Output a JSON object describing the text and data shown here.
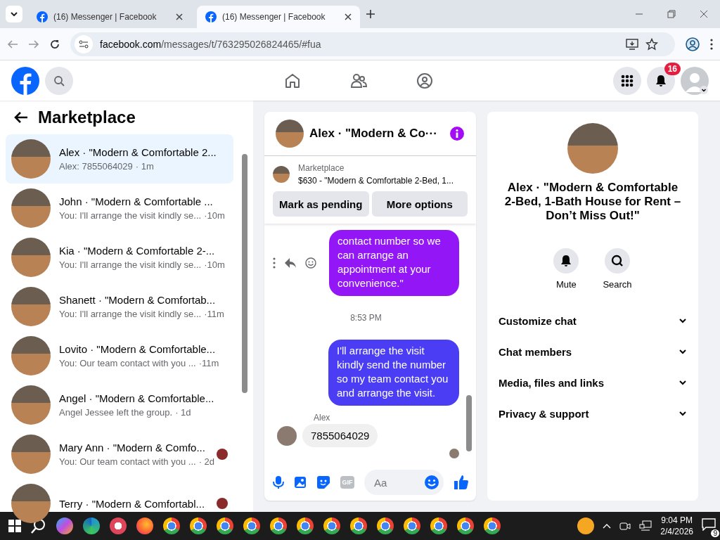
{
  "browser": {
    "tabs": [
      {
        "title": "(16) Messenger | Facebook",
        "selected": false
      },
      {
        "title": "(16) Messenger | Facebook",
        "selected": true
      }
    ],
    "url_host": "facebook.com",
    "url_path": "/messages/t/763295026824465/#fua"
  },
  "header": {
    "notification_count": "16"
  },
  "sidebar": {
    "title": "Marketplace",
    "conversations": [
      {
        "name": "Alex · \"Modern & Comfortable 2...",
        "preview": "Alex: 7855064029",
        "time": "· 1m",
        "selected": true,
        "seen": false
      },
      {
        "name": "John · \"Modern & Comfortable ...",
        "preview": "You: I'll arrange the visit kindly se...",
        "time": "·10m",
        "selected": false,
        "seen": false
      },
      {
        "name": "Kia · \"Modern & Comfortable 2-...",
        "preview": "You: I'll arrange the visit kindly se...",
        "time": "·10m",
        "selected": false,
        "seen": false
      },
      {
        "name": "Shanett · \"Modern & Comfortab...",
        "preview": "You: I'll arrange the visit kindly se...",
        "time": "·11m",
        "selected": false,
        "seen": false
      },
      {
        "name": "Lovito · \"Modern & Comfortable...",
        "preview": "You: Our team contact with you ...",
        "time": "·11m",
        "selected": false,
        "seen": false
      },
      {
        "name": "Angel · \"Modern & Comfortable...",
        "preview": "Angel Jessee left the group.",
        "time": "· 1d",
        "selected": false,
        "seen": false
      },
      {
        "name": "Mary Ann · \"Modern & Comfo...",
        "preview": "You: Our team contact with you ...",
        "time": "· 2d",
        "selected": false,
        "seen": true
      },
      {
        "name": "Terry · \"Modern & Comfortabl...",
        "selected": false,
        "seen": true
      }
    ]
  },
  "chat": {
    "title": "Alex · \"Modern & Co···",
    "listing_label": "Marketplace",
    "listing_text": "$630 - \"Modern & Comfortable 2-Bed, 1...",
    "buttons": [
      "Mark as pending",
      "More options"
    ],
    "messages": [
      {
        "kind": "outgoing",
        "text": "contact number so we can arrange an appointment at your convenience.\"",
        "color": "#9316f6"
      },
      {
        "kind": "timestamp",
        "text": "8:53 PM"
      },
      {
        "kind": "outgoing",
        "text": "I'll arrange the visit kindly send the number so my team contact you and arrange the visit.",
        "color": "#4a3df3"
      },
      {
        "kind": "incoming",
        "sender": "Alex",
        "text": "7855064029"
      }
    ],
    "gif_label": "GIF",
    "placeholder": "Aa"
  },
  "details": {
    "title": "Alex · \"Modern & Comfortable 2-Bed, 1-Bath House for Rent – Don’t Miss Out!\"",
    "actions": [
      {
        "kind": "bell",
        "label": "Mute"
      },
      {
        "kind": "search",
        "label": "Search"
      }
    ],
    "sections": [
      {
        "label": "Customize chat",
        "expanded": false
      },
      {
        "label": "Chat members",
        "expanded": false
      },
      {
        "label": "Media, files and links",
        "expanded": false
      },
      {
        "label": "Privacy & support",
        "expanded": false
      }
    ]
  },
  "taskbar": {
    "time": "9:04 PM",
    "date": "2/4/2026",
    "notification_count": "9"
  }
}
